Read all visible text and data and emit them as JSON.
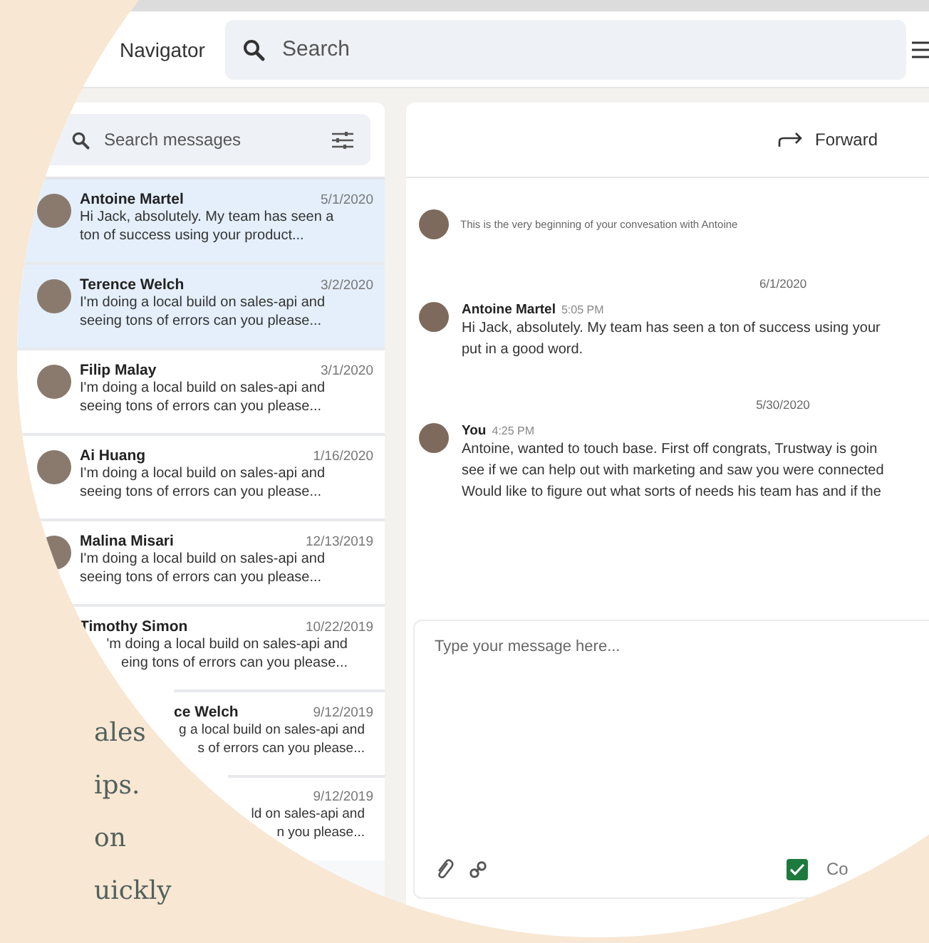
{
  "headline_fragments": [
    "ales",
    "ips.",
    "on",
    "uickly"
  ],
  "header": {
    "logo": "Navigator",
    "search": {
      "placeholder": "Search"
    }
  },
  "message_list": {
    "search": {
      "placeholder": "Search messages"
    },
    "conversations": [
      {
        "kind": "full",
        "name": "Antoine Martel",
        "date": "5/1/2020",
        "lines": [
          "Hi Jack, absolutely. My team has seen a",
          "ton of success using your product..."
        ],
        "selected": true
      },
      {
        "kind": "full",
        "name": "Terence Welch",
        "date": "3/2/2020",
        "lines": [
          "I'm doing a local build on sales-api and",
          "seeing tons of errors can you please..."
        ],
        "selected": true
      },
      {
        "kind": "full",
        "name": "Filip Malay",
        "date": "3/1/2020",
        "lines": [
          "I'm doing a local build on sales-api and",
          "seeing tons of errors can you please..."
        ],
        "selected": false
      },
      {
        "kind": "full",
        "name": "Ai Huang",
        "date": "1/16/2020",
        "lines": [
          "I'm doing a local build on sales-api and",
          "seeing tons of errors can you please..."
        ],
        "selected": false
      },
      {
        "kind": "full",
        "name": "Malina Misari",
        "date": "12/13/2019",
        "lines": [
          "I'm doing a local build on sales-api and",
          "seeing tons of errors can you please..."
        ],
        "selected": false
      },
      {
        "kind": "edge",
        "name": "Timothy Simon",
        "date": "10/22/2019",
        "lines": [
          "'m doing a local build on sales-api and",
          "eing tons of errors can you please..."
        ],
        "selected": false
      },
      {
        "kind": "hidden-start",
        "name": "ce Welch",
        "date": "9/12/2019",
        "lines": [
          "g a local build on sales-api and",
          "s of errors can you please..."
        ],
        "selected": false
      },
      {
        "kind": "hidden-more",
        "date": "9/12/2019",
        "lines": [
          "ld on sales-api and",
          "n you please..."
        ],
        "selected": false
      }
    ]
  },
  "conversation": {
    "forward_button": "Forward",
    "items": [
      {
        "kind": "notice",
        "text": "This is the very beginning of your convesation with Antoine"
      },
      {
        "kind": "date",
        "text": "6/1/2020"
      },
      {
        "kind": "message",
        "sender": "Antoine Martel",
        "time": "5:05 PM",
        "lines": [
          "Hi Jack, absolutely. My team has seen a ton of success using your",
          "put in a good word."
        ]
      },
      {
        "kind": "date",
        "text": "5/30/2020"
      },
      {
        "kind": "message",
        "sender": "You",
        "time": "4:25 PM",
        "lines": [
          "Antoine, wanted to touch base. First off congrats, Trustway is goin",
          "see if we can help out with marketing and saw you were connected",
          "Would like to figure out what sorts of needs his team has and if the"
        ]
      }
    ]
  },
  "composer": {
    "placeholder": "Type your message here...",
    "checkbox": {
      "checked": true,
      "label": "Co"
    }
  }
}
